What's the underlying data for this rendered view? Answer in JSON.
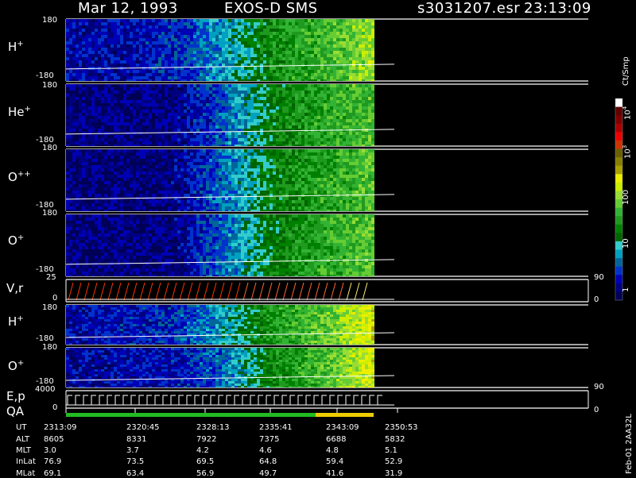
{
  "header": {
    "date": "Mar 12, 1993",
    "instrument": "EXOS-D SMS",
    "file": "s3031207.esr",
    "time": "23:13:09"
  },
  "panel_labels": {
    "p1": {
      "species": "H",
      "charge": "+",
      "top": "180",
      "bottom": "-180"
    },
    "p2": {
      "species": "He",
      "charge": "+",
      "top": "180",
      "bottom": "-180"
    },
    "p3": {
      "species": "O",
      "charge": "++",
      "top": "180",
      "bottom": "-180"
    },
    "p4": {
      "species": "O",
      "charge": "+",
      "top": "180",
      "bottom": "-180"
    },
    "p5": {
      "label": "V,r",
      "top": "25",
      "bottom": "0",
      "right_top": "90",
      "right_bottom": "0"
    },
    "p6": {
      "species": "H",
      "charge": "+",
      "top": "180",
      "bottom": "-180"
    },
    "p7": {
      "species": "O",
      "charge": "+",
      "top": "180",
      "bottom": "-180"
    },
    "p8": {
      "label1": "E,p",
      "label2": "QA",
      "top": "4000",
      "bottom": "0",
      "right_top": "90",
      "right_bottom": "0"
    }
  },
  "colorbar": {
    "unit": "Ct/Smp",
    "ticks": [
      "10",
      "10",
      "100",
      "10",
      "1"
    ],
    "tick_exponents": [
      "4",
      "3",
      "",
      "",
      ""
    ],
    "colors": [
      "#000055",
      "#00007f",
      "#0000b5",
      "#0033cc",
      "#006699",
      "#00a0c0",
      "#33cccc",
      "#006400",
      "#008000",
      "#1f9a1f",
      "#33b333",
      "#66cc33",
      "#99dd33",
      "#ccee00",
      "#eeee00",
      "#aaa000",
      "#8a8000",
      "#6a6000",
      "#cc3300",
      "#ee0000",
      "#aa0000",
      "#800000",
      "#600000",
      "#ffffff"
    ]
  },
  "footer": {
    "rows": [
      {
        "label": "UT",
        "values": [
          "2313:09",
          "2320:45",
          "2328:13",
          "2335:41",
          "2343:09",
          "2350:53"
        ]
      },
      {
        "label": "ALT",
        "values": [
          "8605",
          "8331",
          "7922",
          "7375",
          "6688",
          "5832"
        ]
      },
      {
        "label": "MLT",
        "values": [
          "3.0",
          "3.7",
          "4.2",
          "4.6",
          "4.8",
          "5.1"
        ]
      },
      {
        "label": "InLat",
        "values": [
          "76.9",
          "73.5",
          "69.5",
          "64.8",
          "59.4",
          "52.9"
        ]
      },
      {
        "label": "MLat",
        "values": [
          "69.1",
          "63.4",
          "56.9",
          "49.7",
          "41.6",
          "31.9"
        ]
      }
    ],
    "side_tag": "Feb-01 2AA32L"
  },
  "chart_data": {
    "type": "heatmap",
    "title": "Mar 12, 1993 EXOS-D SMS",
    "x_ticks": [
      "2313:09",
      "2320:45",
      "2328:13",
      "2335:41",
      "2343:09",
      "2350:53"
    ],
    "panels": [
      {
        "name": "H+",
        "ylim": [
          -180,
          180
        ],
        "level_profile": [
          0.1,
          0.1,
          0.14,
          0.28,
          0.5,
          0.58,
          0.72
        ]
      },
      {
        "name": "He+",
        "ylim": [
          -180,
          180
        ],
        "level_profile": [
          0.05,
          0.05,
          0.05,
          0.2,
          0.45,
          0.55,
          0.62
        ]
      },
      {
        "name": "O++",
        "ylim": [
          -180,
          180
        ],
        "level_profile": [
          0.05,
          0.05,
          0.05,
          0.22,
          0.45,
          0.55,
          0.62
        ]
      },
      {
        "name": "O+",
        "ylim": [
          -180,
          180
        ],
        "level_profile": [
          0.05,
          0.05,
          0.05,
          0.22,
          0.45,
          0.55,
          0.62
        ]
      },
      {
        "name": "V,r",
        "ylim": [
          0,
          25
        ],
        "right_ylim": [
          0,
          90
        ]
      },
      {
        "name": "H+",
        "ylim": [
          -180,
          180
        ],
        "level_profile": [
          0.1,
          0.12,
          0.15,
          0.3,
          0.52,
          0.64,
          0.8
        ]
      },
      {
        "name": "O+",
        "ylim": [
          -180,
          180
        ],
        "level_profile": [
          0.08,
          0.1,
          0.12,
          0.22,
          0.48,
          0.6,
          0.8
        ]
      },
      {
        "name": "E,p / QA",
        "ylim": [
          0,
          4000
        ],
        "right_ylim": [
          0,
          90
        ]
      }
    ],
    "colorbar_scale": "log",
    "colorbar_range": [
      1,
      10000
    ],
    "colorbar_unit": "Ct/Smp"
  }
}
